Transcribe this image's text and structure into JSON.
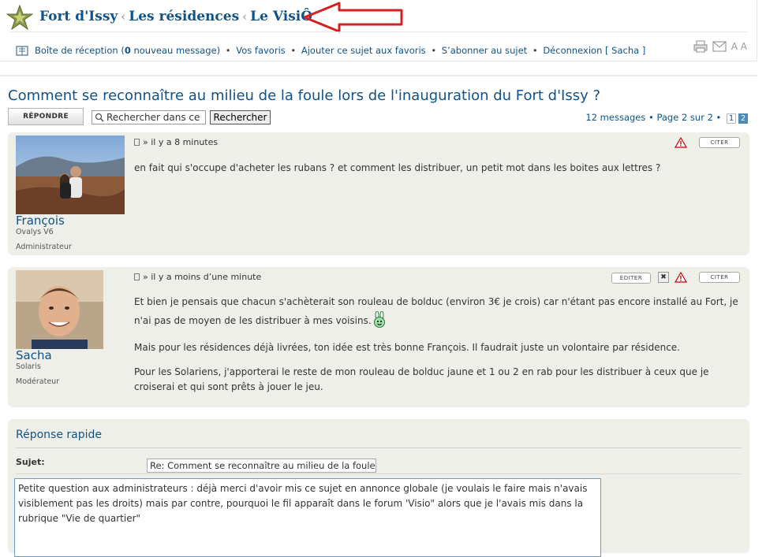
{
  "header": {
    "crumbs": [
      "Fort d'Issy",
      "Les résidences",
      "Le VisiÔ"
    ],
    "separator": "‹",
    "nav": {
      "inbox_prefix": "Boîte de réception (",
      "inbox_count": "0",
      "inbox_suffix": " nouveau message)",
      "favorites": "Vos favoris",
      "add_favorite": "Ajouter ce sujet aux favoris",
      "subscribe": "S’abonner au sujet",
      "logout": "Déconnexion [ Sacha ]",
      "bullet": "•"
    },
    "font_tool": "A A"
  },
  "topic": {
    "title": "Comment se reconnaître au milieu de la foule lors de l'inauguration du Fort d'Issy ?",
    "reply_label": "RÉPONDRE",
    "search_placeholder": "Rechercher dans ce",
    "search_button": "Rechercher",
    "pagination_text": "12 messages • Page 2 sur 2 •",
    "pages": [
      "1",
      "2"
    ]
  },
  "posts": [
    {
      "author": "François",
      "rank": "Ovalys V6",
      "role": "Administrateur",
      "meta": "» il y a 8 minutes",
      "quote_label": "CITER",
      "body": [
        "en fait qui s'occupe d'acheter les rubans ? et comment les distribuer, un petit mot dans les boites aux lettres ?"
      ]
    },
    {
      "author": "Sacha",
      "rank": "Solaris",
      "role": "Modérateur",
      "meta": "» il y a moins d’une minute",
      "edit_label": "ÉDITER",
      "quote_label": "CITER",
      "body": [
        "Et bien je pensais que chacun s'achèterait son rouleau de bolduc (environ 3€ je crois) car n'étant pas encore installé au Fort, je n'ai pas de moyen de les distribuer à mes voisins.",
        "Mais pour les résidences déjà livrées, ton idée est très bonne François. Il faudrait juste un volontaire par résidence.",
        "Pour les Solariens, j'apporterai le reste de mon rouleau de bolduc jaune et 1 ou 2 en rab pour les distribuer à ceux que je croiserai et qui sont prêts à jouer le jeu."
      ]
    }
  ],
  "quick_reply": {
    "title": "Réponse rapide",
    "subject_label": "Sujet:",
    "subject_value": "Re: Comment se reconnaître au milieu de la foule",
    "message": "Petite question aux administrateurs : déjà merci d'avoir mis ce sujet en annonce globale (je voulais le faire mais n'avais visiblement pas les droits) mais par contre, pourquoi le fil apparaît dans le forum 'Visio\" alors que je l'avais mis dans la rubrique \"Vie de quartier\""
  },
  "colors": {
    "link": "#105289",
    "post_bg": "#efefea",
    "arrow": "#d42020"
  }
}
